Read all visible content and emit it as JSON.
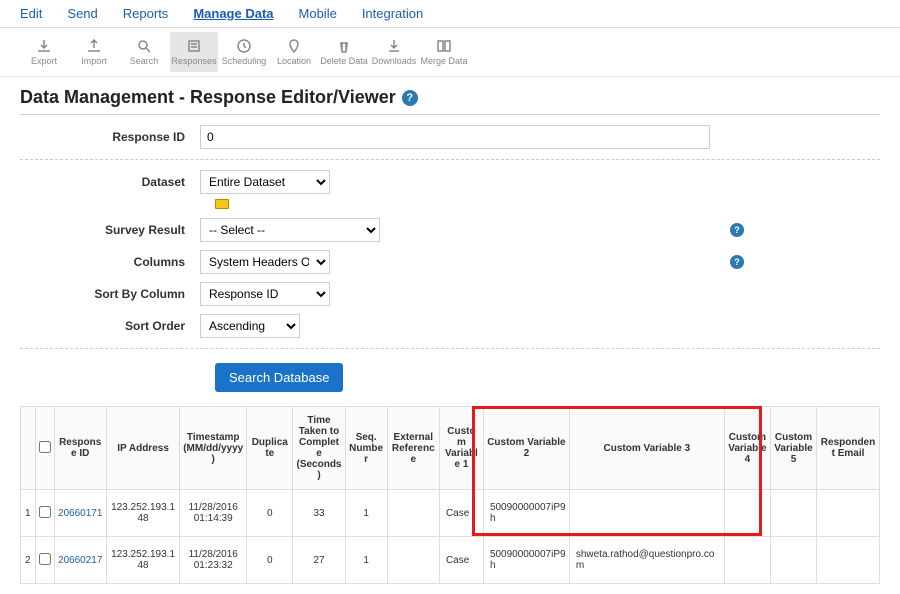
{
  "topNav": {
    "edit": "Edit",
    "send": "Send",
    "reports": "Reports",
    "manageData": "Manage Data",
    "mobile": "Mobile",
    "integration": "Integration"
  },
  "toolbar": {
    "export": "Export",
    "import": "Import",
    "search": "Search",
    "responses": "Responses",
    "scheduling": "Scheduling",
    "location": "Location",
    "deleteData": "Delete Data",
    "downloads": "Downloads",
    "mergeData": "Merge Data"
  },
  "page": {
    "title": "Data Management - Response Editor/Viewer"
  },
  "form": {
    "responseIdLabel": "Response ID",
    "responseIdValue": "0",
    "datasetLabel": "Dataset",
    "datasetValue": "Entire Dataset",
    "surveyResultLabel": "Survey Result",
    "surveyResultValue": "-- Select --",
    "columnsLabel": "Columns",
    "columnsValue": "System Headers Only",
    "sortByLabel": "Sort By Column",
    "sortByValue": "Response ID",
    "sortOrderLabel": "Sort Order",
    "sortOrderValue": "Ascending",
    "searchBtn": "Search Database"
  },
  "table": {
    "headers": {
      "responseId": "Response ID",
      "ip": "IP Address",
      "timestamp": "Timestamp (MM/dd/yyyy)",
      "duplicate": "Duplicate",
      "timeTaken": "Time Taken to Complete (Seconds)",
      "seq": "Seq. Number",
      "extRef": "External Reference",
      "cv1": "Custom Variable 1",
      "cv2": "Custom Variable 2",
      "cv3": "Custom Variable 3",
      "cv4": "Custom Variable 4",
      "cv5": "Custom Variable 5",
      "email": "Respondent Email"
    },
    "rows": [
      {
        "n": "1",
        "responseId": "20660171",
        "ip": "123.252.193.148",
        "timestamp": "11/28/2016 01:14:39",
        "duplicate": "0",
        "timeTaken": "33",
        "seq": "1",
        "extRef": "",
        "cv1": "Case",
        "cv2": "50090000007iP9h",
        "cv3": "",
        "cv4": "",
        "cv5": "",
        "email": ""
      },
      {
        "n": "2",
        "responseId": "20660217",
        "ip": "123.252.193.148",
        "timestamp": "11/28/2016 01:23:32",
        "duplicate": "0",
        "timeTaken": "27",
        "seq": "1",
        "extRef": "",
        "cv1": "Case",
        "cv2": "50090000007iP9h",
        "cv3": "shweta.rathod@questionpro.com",
        "cv4": "",
        "cv5": "",
        "email": ""
      }
    ]
  }
}
